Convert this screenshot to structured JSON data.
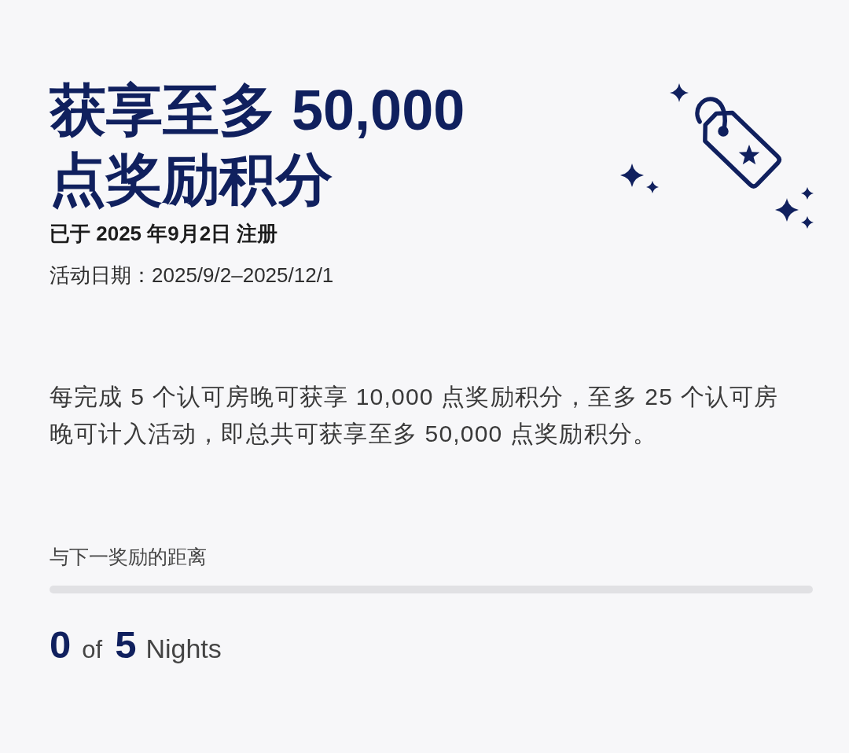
{
  "promotion": {
    "title": "获享至多 50,000 点奖励积分",
    "registered": "已于 2025 年9月2日 注册",
    "campaign_dates": "活动日期：2025/9/2–2025/12/1",
    "description": "每完成 5 个认可房晚可获享 10,000 点奖励积分，至多 25 个认可房晚可计入活动，即总共可获享至多 50,000 点奖励积分。"
  },
  "progress": {
    "label": "与下一奖励的距离",
    "level": 0,
    "current": "0",
    "of": "of",
    "target": "5",
    "unit": "Nights"
  }
}
